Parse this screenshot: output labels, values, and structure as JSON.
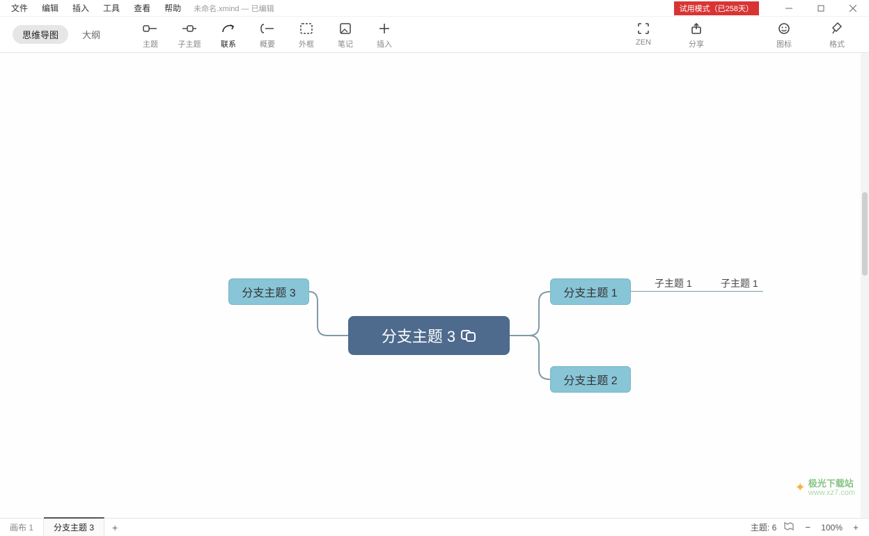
{
  "menu": {
    "items": [
      "文件",
      "编辑",
      "插入",
      "工具",
      "查看",
      "帮助"
    ]
  },
  "document": {
    "title": "未命名.xmind  — 已编辑"
  },
  "trial": {
    "text": "试用模式（已258天）"
  },
  "view_toggle": {
    "mindmap": "思维导图",
    "outline": "大纲"
  },
  "tools": {
    "topic": "主题",
    "subtopic": "子主题",
    "relationship": "联系",
    "summary": "概要",
    "boundary": "外框",
    "note": "笔记",
    "insert": "插入",
    "zen": "ZEN",
    "share": "分享",
    "icons": "图标",
    "format": "格式"
  },
  "nodes": {
    "central": "分支主题 3",
    "branch1": "分支主题 1",
    "branch2": "分支主题 2",
    "branch3": "分支主题 3",
    "sub1a": "子主题 1",
    "sub1b": "子主题 1"
  },
  "status": {
    "sheet1": "画布 1",
    "sheet2": "分支主题 3",
    "topic_count_label": "主题:",
    "topic_count": "6",
    "zoom": "100%"
  },
  "watermark": {
    "brand": "极光下载站",
    "site": "www.xz7.com"
  }
}
